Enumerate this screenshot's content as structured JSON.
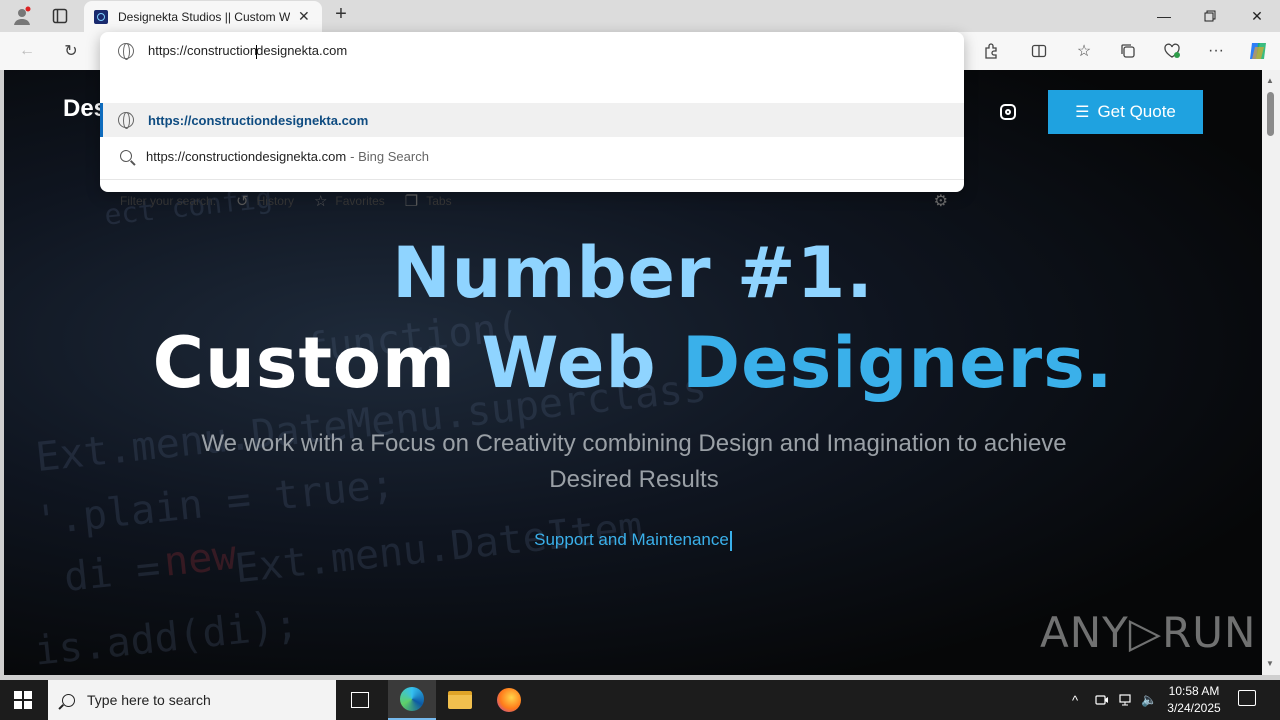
{
  "browser": {
    "tab_title": "Designekta Studios || Custom We",
    "new_tab_symbol": "+",
    "close_symbol": "✕",
    "address": {
      "value_before_caret": "https://construction",
      "value_after_caret": "designekta.com"
    },
    "suggestions": [
      {
        "text": "https://constructiondesignekta.com",
        "sub": ""
      },
      {
        "text": "https://constructiondesignekta.com",
        "sub": "- Bing Search"
      }
    ],
    "filter": {
      "label": "Filter your search:",
      "chips": [
        "History",
        "Favorites",
        "Tabs"
      ]
    }
  },
  "site": {
    "brand": "Desi",
    "cta": "Get Quote",
    "headline_line1": "Number #1.",
    "headline_line2_a": "Custom ",
    "headline_line2_b": "Web ",
    "headline_line2_c": "Designers.",
    "lead": "We work with a Focus on Creativity combining Design and Imagination to achieve Desired Results",
    "typed_text": "Support and Maintenance",
    "code_lines": [
      "ect config",
      "function(",
      "Ext.menu.DateMenu.superclass",
      "'.plain = true;",
      "di = ",
      "new",
      " Ext.menu.DateItem",
      "is.add(di);"
    ],
    "watermark": "ANY▷RUN"
  },
  "taskbar": {
    "search_placeholder": "Type here to search",
    "time": "10:58 AM",
    "date": "3/24/2025"
  },
  "colors": {
    "accent_blue": "#1fa2e0",
    "headline_light": "#8fd4ff",
    "headline_mid": "#3ab0ea"
  }
}
